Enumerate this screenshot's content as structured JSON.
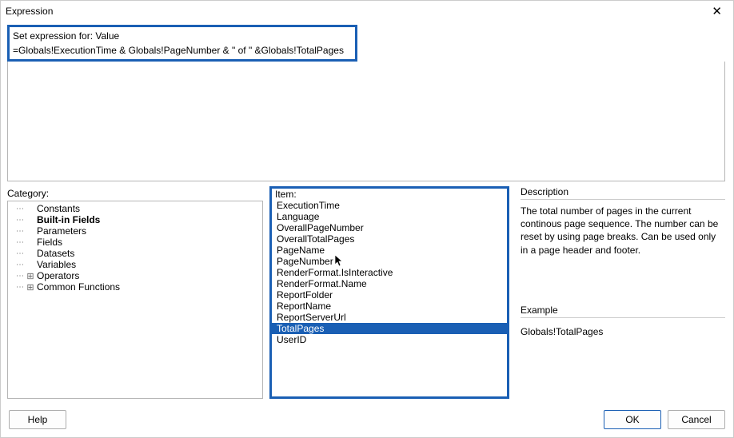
{
  "title": "Expression",
  "expression_label": "Set expression for: Value",
  "expression_value": "=Globals!ExecutionTime & Globals!PageNumber & \" of \" &Globals!TotalPages",
  "category_label": "Category:",
  "item_label": "Item:",
  "description_label": "Description",
  "description_text": "The total number of pages in the current continous page sequence. The number can be reset by using page breaks. Can be used only in a page header and footer.",
  "example_label": "Example",
  "example_text": "Globals!TotalPages",
  "buttons": {
    "help": "Help",
    "ok": "OK",
    "cancel": "Cancel"
  },
  "category_tree": [
    {
      "label": "Constants",
      "expand": "",
      "bold": false
    },
    {
      "label": "Built-in Fields",
      "expand": "",
      "bold": true
    },
    {
      "label": "Parameters",
      "expand": "",
      "bold": false
    },
    {
      "label": "Fields",
      "expand": "",
      "bold": false
    },
    {
      "label": "Datasets",
      "expand": "",
      "bold": false
    },
    {
      "label": "Variables",
      "expand": "",
      "bold": false
    },
    {
      "label": "Operators",
      "expand": "+",
      "bold": false
    },
    {
      "label": "Common Functions",
      "expand": "+",
      "bold": false
    }
  ],
  "items": [
    {
      "label": "ExecutionTime",
      "selected": false,
      "cursor": false
    },
    {
      "label": "Language",
      "selected": false,
      "cursor": false
    },
    {
      "label": "OverallPageNumber",
      "selected": false,
      "cursor": false
    },
    {
      "label": "OverallTotalPages",
      "selected": false,
      "cursor": false
    },
    {
      "label": "PageName",
      "selected": false,
      "cursor": false
    },
    {
      "label": "PageNumber",
      "selected": false,
      "cursor": true
    },
    {
      "label": "RenderFormat.IsInteractive",
      "selected": false,
      "cursor": false
    },
    {
      "label": "RenderFormat.Name",
      "selected": false,
      "cursor": false
    },
    {
      "label": "ReportFolder",
      "selected": false,
      "cursor": false
    },
    {
      "label": "ReportName",
      "selected": false,
      "cursor": false
    },
    {
      "label": "ReportServerUrl",
      "selected": false,
      "cursor": false
    },
    {
      "label": "TotalPages",
      "selected": true,
      "cursor": false
    },
    {
      "label": "UserID",
      "selected": false,
      "cursor": false
    }
  ]
}
